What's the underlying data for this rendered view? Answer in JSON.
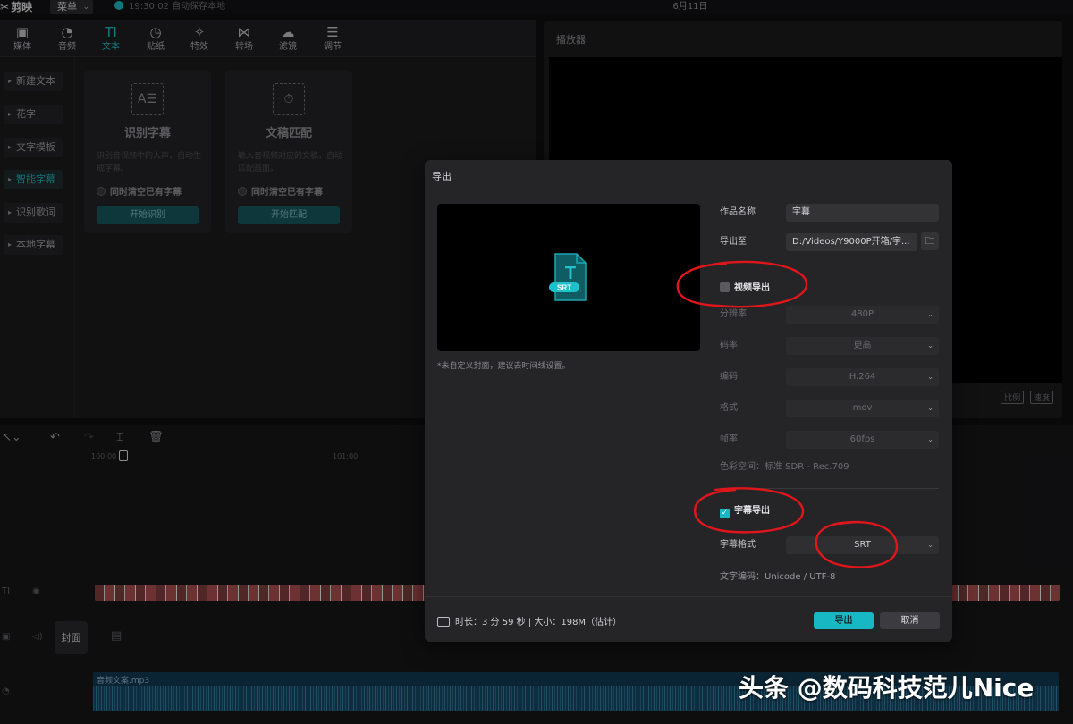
{
  "app": {
    "name": "剪映",
    "menu_label": "菜单",
    "save_status": "19:30:02 自动保存本地",
    "project_title": "6月11日"
  },
  "tabs": [
    {
      "icon": "media-icon",
      "label": "媒体"
    },
    {
      "icon": "audio-icon",
      "label": "音频"
    },
    {
      "icon": "text-icon",
      "label": "文本",
      "active": true
    },
    {
      "icon": "sticker-icon",
      "label": "贴纸"
    },
    {
      "icon": "effects-icon",
      "label": "特效"
    },
    {
      "icon": "transition-icon",
      "label": "转场"
    },
    {
      "icon": "filter-icon",
      "label": "滤镜"
    },
    {
      "icon": "adjust-icon",
      "label": "调节"
    }
  ],
  "sidebar": {
    "items": [
      {
        "label": "新建文本"
      },
      {
        "label": "花字"
      },
      {
        "label": "文字模板"
      },
      {
        "label": "智能字幕",
        "active": true
      },
      {
        "label": "识别歌词"
      },
      {
        "label": "本地字幕"
      }
    ]
  },
  "cards": [
    {
      "title": "识别字幕",
      "desc": "识别音视频中的人声，自动生成字幕。",
      "checkbox": "同时清空已有字幕",
      "button": "开始识别"
    },
    {
      "title": "文稿匹配",
      "desc": "输入音视频对应的文稿，自动匹配画面。",
      "checkbox": "同时清空已有字幕",
      "button": "开始匹配"
    }
  ],
  "player": {
    "title": "播放器",
    "ratio_label": "比例",
    "speed_label": "速度"
  },
  "timeline": {
    "ruler": [
      "100:00",
      "101:00"
    ],
    "cover_label": "封面",
    "audio_name": "音频文案.mp3"
  },
  "dialog": {
    "title": "导出",
    "preview_badge": "SRT",
    "preview_note": "*未自定义封面，建议去时间线设置。",
    "name_label": "作品名称",
    "name_value": "字幕",
    "export_to_label": "导出至",
    "export_to_value": "D:/Videos/Y9000P开箱/字...",
    "video_section": {
      "label": "视频导出",
      "checked": false,
      "resolution_label": "分辨率",
      "resolution_value": "480P",
      "bitrate_label": "码率",
      "bitrate_value": "更高",
      "codec_label": "编码",
      "codec_value": "H.264",
      "format_label": "格式",
      "format_value": "mov",
      "fps_label": "帧率",
      "fps_value": "60fps",
      "colorspace_text": "色彩空间：标准 SDR - Rec.709"
    },
    "subtitle_section": {
      "label": "字幕导出",
      "checked": true,
      "format_label": "字幕格式",
      "format_value": "SRT",
      "encoding_text": "文字编码：Unicode / UTF-8"
    },
    "footer_info": "时长：3 分 59 秒 | 大小：198M（估计）",
    "export_button": "导出",
    "cancel_button": "取消"
  },
  "watermark": "头条 @数码科技范儿Nice",
  "colors": {
    "accent": "#17b8c4",
    "annotation": "#e0161b",
    "background": "#0e0e10",
    "dialog": "#252528"
  }
}
